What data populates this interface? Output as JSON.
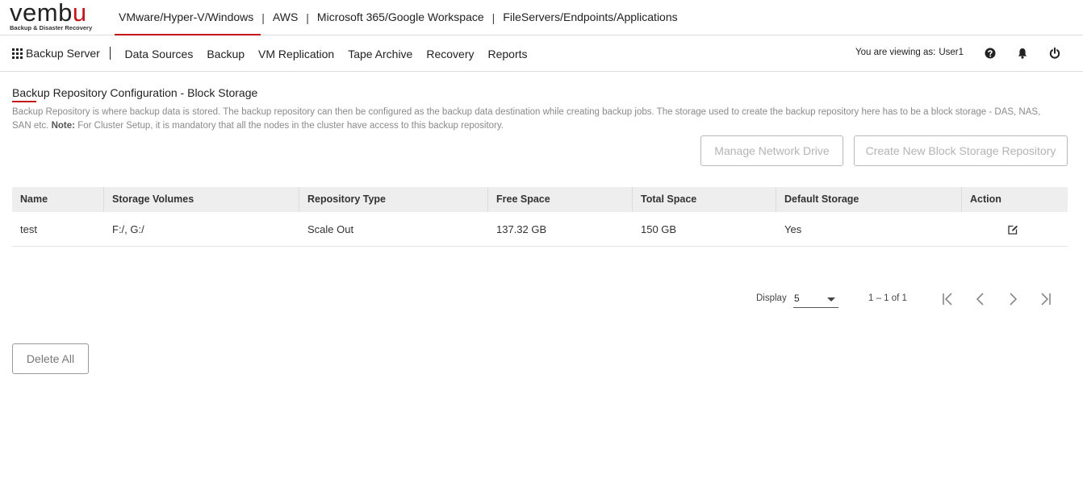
{
  "brand": {
    "logo_prefix": "vemb",
    "logo_accent": "u",
    "tagline": "Backup & Disaster Recovery",
    "accent_color": "#c4161c"
  },
  "top_tabs": [
    {
      "label": "VMware/Hyper-V/Windows",
      "active": true
    },
    {
      "label": "AWS"
    },
    {
      "label": "Microsoft 365/Google Workspace"
    },
    {
      "label": "FileServers/Endpoints/Applications"
    }
  ],
  "top_separator": "|",
  "nav": {
    "app_icon": "grid-icon",
    "server_label": "Backup Server",
    "items": [
      "Data Sources",
      "Backup",
      "VM Replication",
      "Tape Archive",
      "Recovery",
      "Reports"
    ],
    "viewing_label": "You are viewing as:",
    "user": "User1",
    "icons": [
      "help-icon",
      "bell-icon",
      "power-icon"
    ]
  },
  "page": {
    "title": "Backup Repository Configuration - Block Storage",
    "description": "Backup Repository is where backup data is stored. The backup repository can then be configured as the backup data destination while creating backup jobs. The storage used to create the backup repository here has to be a block storage - DAS, NAS, SAN etc.",
    "note_label": "Note:",
    "note_text": "For Cluster Setup, it is mandatory that all the nodes in the cluster have access to this backup repository.",
    "manage_button": "Manage Network Drive",
    "create_button": "Create New Block Storage Repository"
  },
  "table": {
    "headers": [
      "Name",
      "Storage Volumes",
      "Repository Type",
      "Free Space",
      "Total Space",
      "Default Storage",
      "Action"
    ],
    "rows": [
      {
        "name": "test",
        "volumes": "F:/, G:/",
        "type": "Scale Out",
        "free": "137.32 GB",
        "total": "150 GB",
        "default": "Yes",
        "action_icon": "edit-icon"
      }
    ]
  },
  "pagination": {
    "display_label": "Display",
    "page_size": "5",
    "range": "1 – 1 of 1"
  },
  "delete_all_button": "Delete All"
}
